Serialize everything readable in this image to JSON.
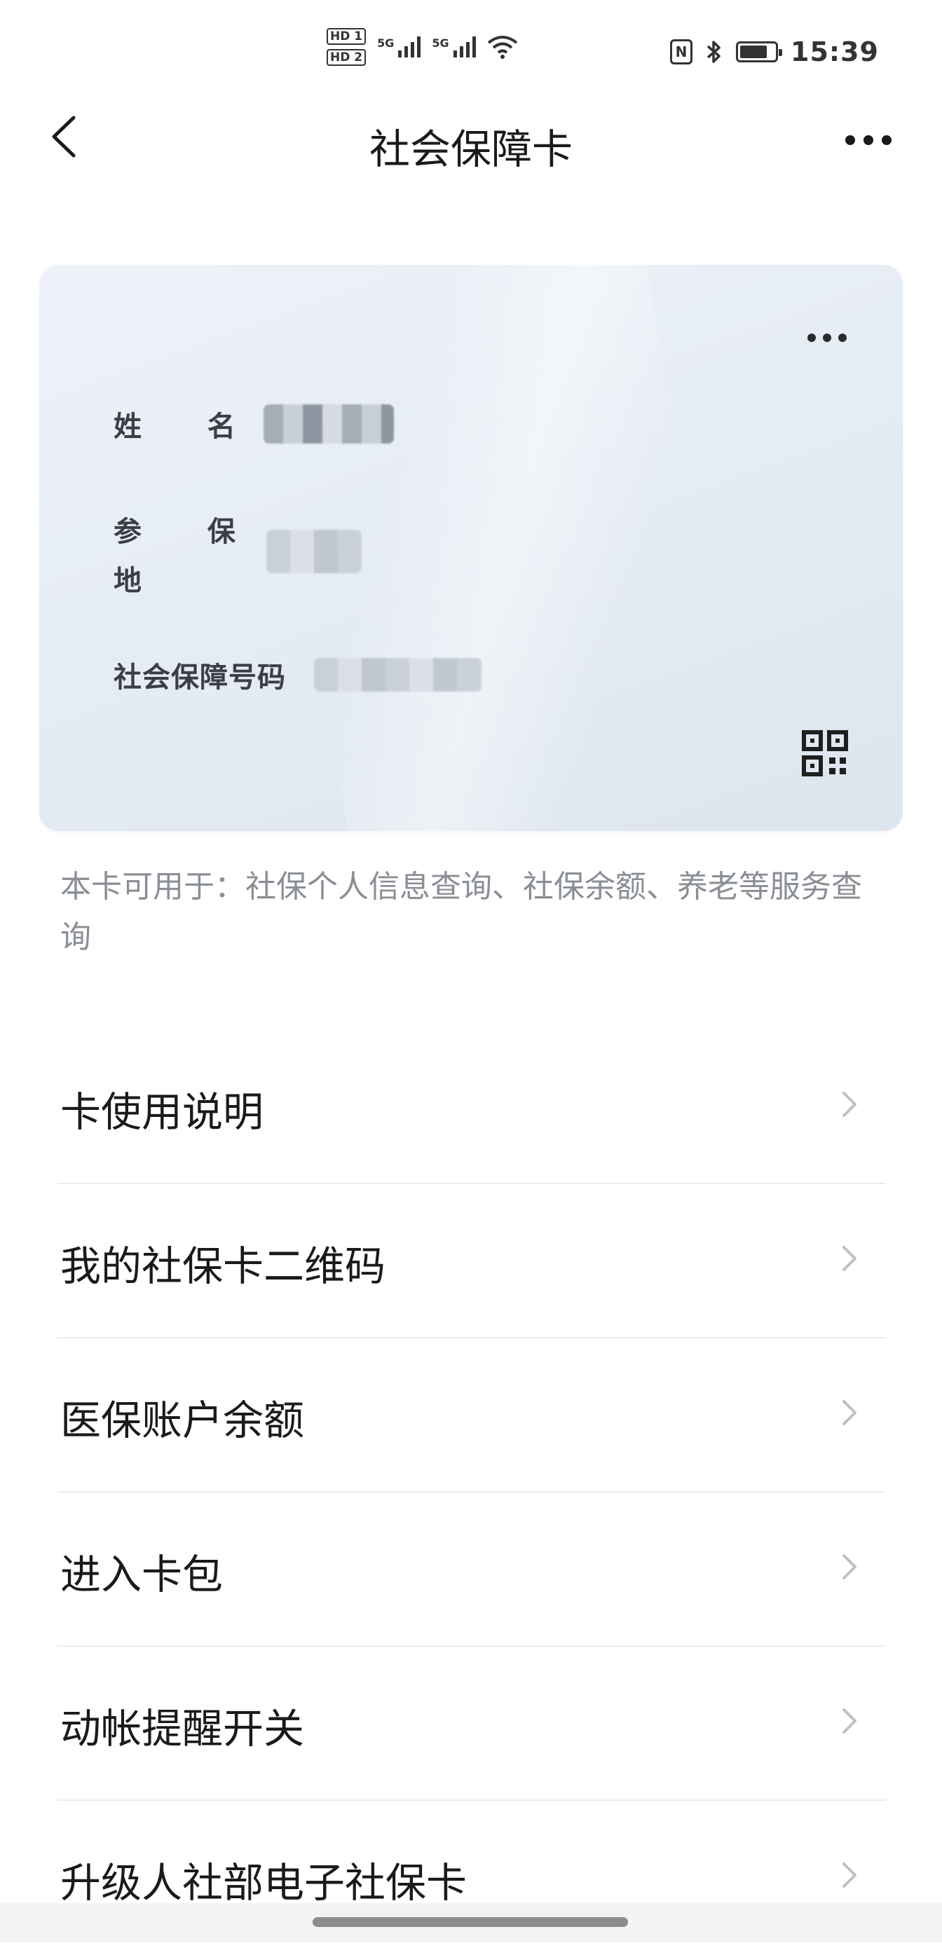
{
  "status_bar": {
    "hd1": "HD 1",
    "hd2": "HD 2",
    "net1": "5G",
    "net2": "5G",
    "nfc": "N",
    "battery_level": 0.8,
    "time": "15:39"
  },
  "nav": {
    "title": "社会保障卡"
  },
  "card": {
    "name_label": "姓  名",
    "region_label_1": "参  保",
    "region_label_2": "地",
    "number_label": "社会保障号码"
  },
  "card_description": "本卡可用于：社保个人信息查询、社保余额、养老等服务查询",
  "menu": [
    {
      "label": "卡使用说明"
    },
    {
      "label": "我的社保卡二维码"
    },
    {
      "label": "医保账户余额"
    },
    {
      "label": "进入卡包"
    },
    {
      "label": "动帐提醒开关"
    },
    {
      "label": "升级人社部电子社保卡"
    }
  ],
  "colors": {
    "accent_text": "#1a1a1a",
    "muted_text": "#8a8f96",
    "card_bg": "#e7edf5"
  }
}
